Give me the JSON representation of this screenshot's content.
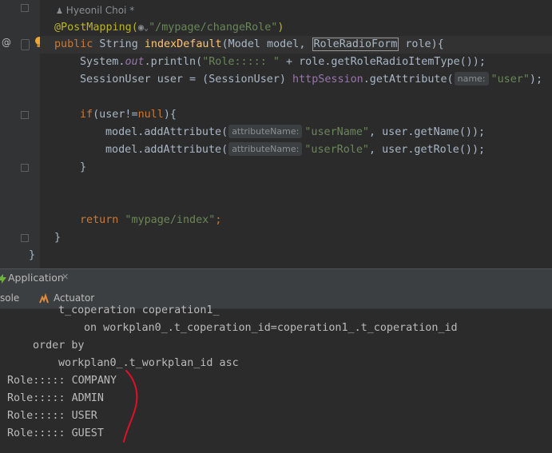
{
  "editor": {
    "author_hint": "Hyeonil Choi *",
    "code": {
      "mapping_annotation": "@PostMapping(",
      "mapping_path": "\"/mypage/changeRole\"",
      "mapping_close": ")",
      "sig_public": "public",
      "sig_type": " String ",
      "sig_method": "indexDefault",
      "sig_params_a": "(Model model, ",
      "sig_param_type": "RoleRadioForm",
      "sig_params_b": " role){",
      "l3_a": "System.",
      "l3_out": "out",
      "l3_b": ".println(",
      "l3_str": "\"Role::::: \"",
      "l3_c": " + role.getRoleRadioItemType());",
      "l4_a": "SessionUser user = (SessionUser) ",
      "l4_var": "httpSession",
      "l4_b": ".getAttribute(",
      "l4_hint": "name:",
      "l4_str": "\"user\"",
      "l4_c": ");",
      "l5_if": "if",
      "l5_a": "(user!=",
      "l5_null": "null",
      "l5_b": "){",
      "l6_a": "model.addAttribute(",
      "l6_hint": "attributeName:",
      "l6_str": "\"userName\"",
      "l6_b": ", user.getName());",
      "l7_a": "model.addAttribute(",
      "l7_hint": "attributeName:",
      "l7_str": "\"userRole\"",
      "l7_b": ", user.getRole());",
      "l8": "}",
      "l9_return": "return",
      "l9_str": " \"mypage/index\"",
      "l9_semi": ";",
      "l10": "}",
      "l11": "}"
    }
  },
  "run_panel": {
    "title": "Application",
    "close_label": "✕",
    "tabs": [
      "sole",
      "Actuator"
    ]
  },
  "console_lines": [
    "t_coperation coperation1_",
    "on workplan0_.t_coperation_id=coperation1_.t_coperation_id",
    "order by",
    "workplan0_.t_workplan_id asc",
    "Role::::: COMPANY",
    "Role::::: ADMIN",
    "Role::::: USER",
    "Role::::: GUEST"
  ],
  "colors": {
    "annotation_mark": "#e0102a"
  },
  "icons": [
    "user-icon",
    "web-icon",
    "chevron-down-icon",
    "bean-icon",
    "lightbulb-icon",
    "spring-boot-icon",
    "actuator-icon"
  ]
}
